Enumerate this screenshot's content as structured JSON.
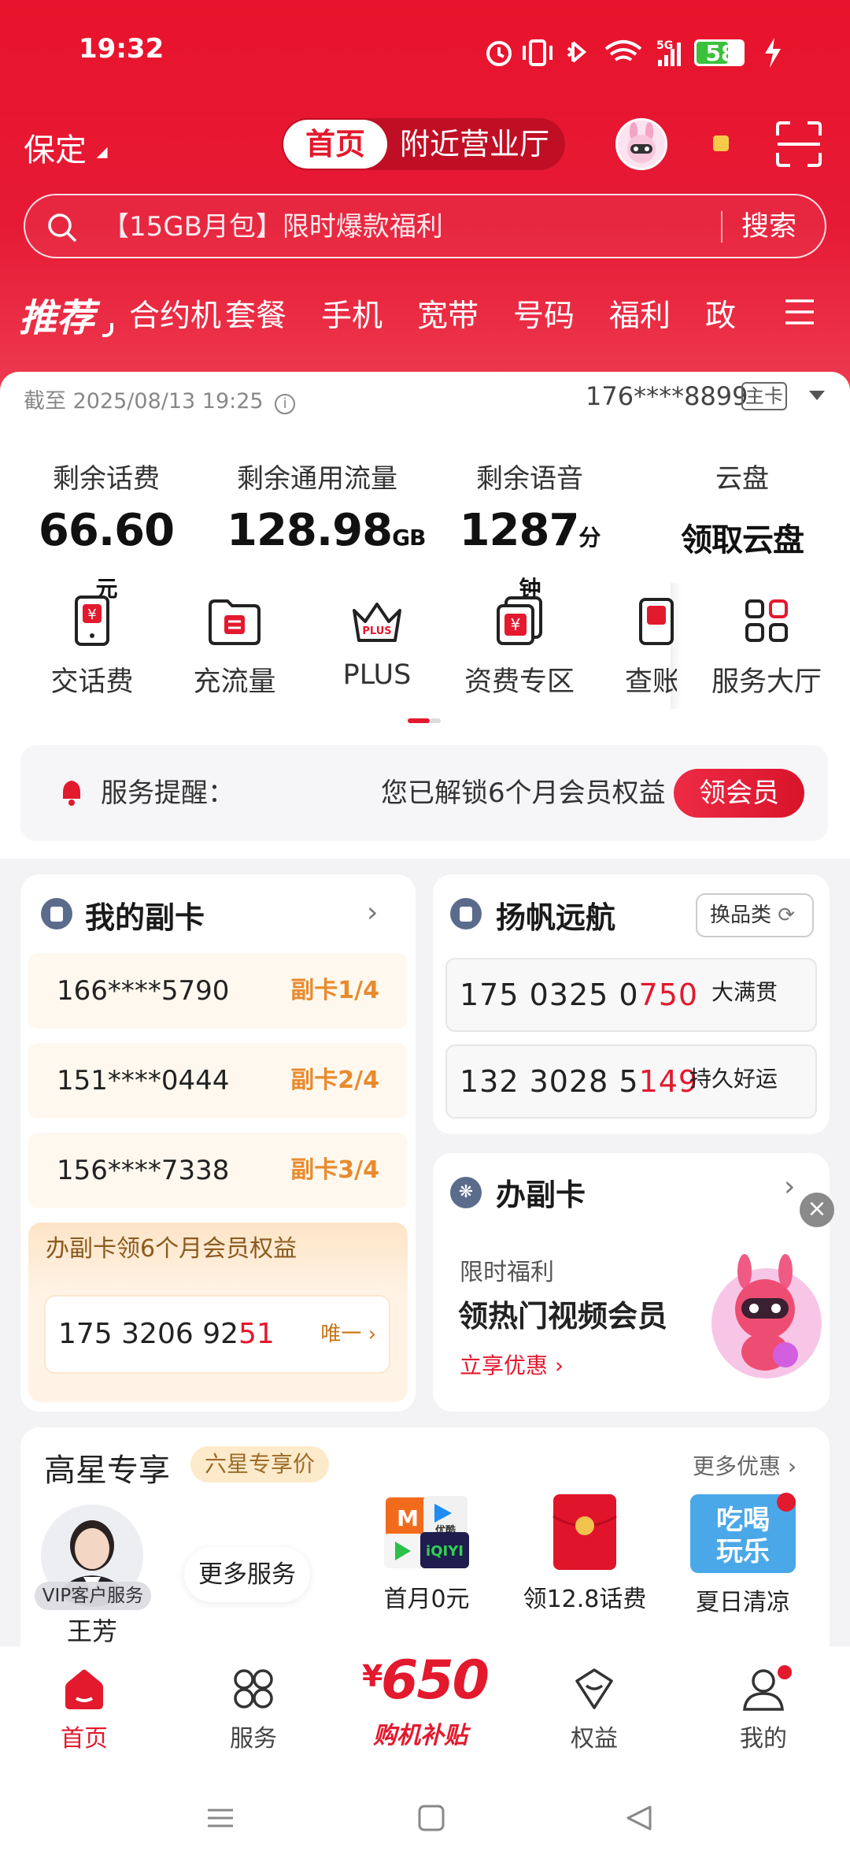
{
  "status_bar": {
    "time": "19:32",
    "battery": "58"
  },
  "header": {
    "city": "保定",
    "toggle": {
      "active": "首页",
      "inactive": "附近营业厅"
    }
  },
  "search": {
    "placeholder": "【15GB月包】限时爆款福利",
    "button": "搜索"
  },
  "category_tabs": {
    "active": "推荐",
    "items": [
      "合约机",
      "套餐",
      "手机",
      "宽带",
      "号码",
      "福利",
      "政"
    ]
  },
  "account": {
    "as_of": "截至 2025/08/13 19:25",
    "phone": "176****8899",
    "badge": "主卡"
  },
  "balances": [
    {
      "title": "剩余话费",
      "value": "66.60",
      "unit": "元"
    },
    {
      "title": "剩余通用流量",
      "value": "128.98",
      "unit": "GB"
    },
    {
      "title": "剩余语音",
      "value": "1287",
      "unit": "分钟"
    },
    {
      "title": "云盘",
      "value": "领取云盘",
      "unit": ""
    }
  ],
  "quick_actions": [
    "交话费",
    "充流量",
    "PLUS",
    "资费专区",
    "查账",
    "服务大厅"
  ],
  "reminder": {
    "label": "服务提醒：",
    "text": "您已解锁6个月会员权益",
    "button": "领会员"
  },
  "sub_cards": {
    "title": "我的副卡",
    "rows": [
      {
        "number": "166****5790",
        "tag": "副卡1/4"
      },
      {
        "number": "151****0444",
        "tag": "副卡2/4"
      },
      {
        "number": "156****7338",
        "tag": "副卡3/4"
      }
    ],
    "promo": "办副卡领6个月会员权益",
    "offer_number_prefix": "175 3206 92",
    "offer_number_suffix": "51",
    "offer_tag": "唯一"
  },
  "lucky_numbers": {
    "title": "扬帆远航",
    "switch": "换品类",
    "rows": [
      {
        "prefix": "175 0325 0",
        "suffix": "750",
        "label": "大满贯"
      },
      {
        "prefix": "132 3028 5",
        "suffix": "149",
        "label": "持久好运"
      }
    ]
  },
  "apply_card": {
    "title": "办副卡",
    "subtitle": "限时福利",
    "headline": "领热门视频会员",
    "link": "立享优惠"
  },
  "star_section": {
    "title": "高星专享",
    "badge": "六星专享价",
    "more": "更多优惠",
    "agent_role": "VIP客户服务",
    "agent_name": "王芳",
    "more_service": "更多服务",
    "products": [
      {
        "label": "首月0元",
        "text1": "优酷",
        "text2": "iQIYI"
      },
      {
        "label": "领12.8话费"
      },
      {
        "label": "夏日清凉",
        "text1": "吃喝",
        "text2": "玩乐"
      }
    ]
  },
  "bottom_nav": {
    "items": [
      "首页",
      "服务",
      "权益",
      "我的"
    ],
    "center_price": "650",
    "center_currency": "¥",
    "center_label": "购机补贴"
  },
  "colors": {
    "brand": "#e3192e",
    "accent_orange": "#e88b2e"
  }
}
